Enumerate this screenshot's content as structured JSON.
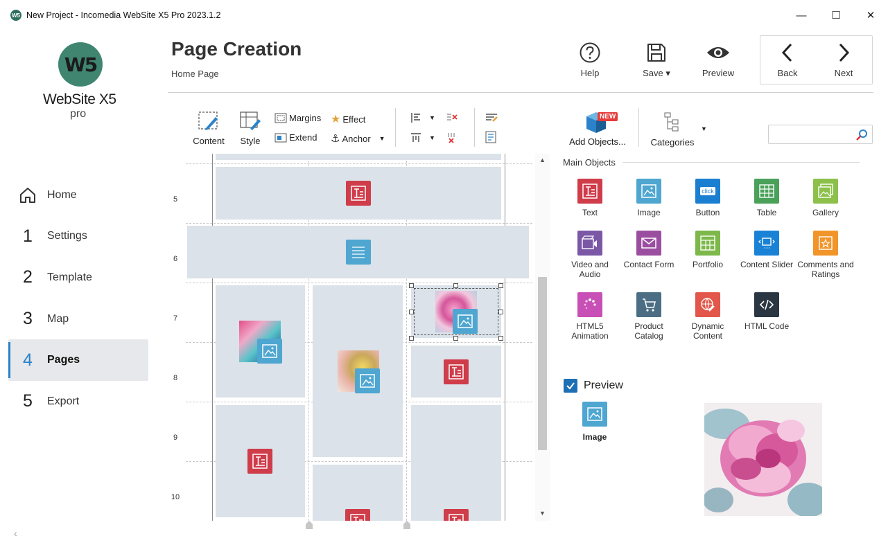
{
  "window": {
    "title": "New Project - Incomedia WebSite X5 Pro 2023.1.2",
    "app_icon_text": "W5",
    "minimize": "—",
    "maximize": "☐",
    "close": "✕"
  },
  "logo": {
    "mark": "W5",
    "name": "WebSite X5",
    "edition": "pro"
  },
  "nav": [
    {
      "num": "",
      "label": "Home"
    },
    {
      "num": "1",
      "label": "Settings"
    },
    {
      "num": "2",
      "label": "Template"
    },
    {
      "num": "3",
      "label": "Map"
    },
    {
      "num": "4",
      "label": "Pages"
    },
    {
      "num": "5",
      "label": "Export"
    }
  ],
  "header": {
    "title": "Page Creation",
    "breadcrumb": "Home Page",
    "help": "Help",
    "save": "Save ▾",
    "preview": "Preview",
    "back": "Back",
    "next": "Next"
  },
  "toolbar": {
    "content": "Content",
    "style": "Style",
    "margins": "Margins",
    "effect": "Effect",
    "extend": "Extend",
    "anchor": "Anchor",
    "add_objects": "Add Objects...",
    "new_badge": "NEW",
    "categories": "Categories",
    "search_placeholder": ""
  },
  "canvas": {
    "rows": [
      "5",
      "6",
      "7",
      "8",
      "9",
      "10"
    ]
  },
  "objects_panel": {
    "section": "Main Objects",
    "items": [
      {
        "name": "Text",
        "color": "#cf3c4a"
      },
      {
        "name": "Image",
        "color": "#4ea6d1"
      },
      {
        "name": "Button",
        "color": "#1b7fd1"
      },
      {
        "name": "Table",
        "color": "#4aa15a"
      },
      {
        "name": "Gallery",
        "color": "#8cc04b"
      },
      {
        "name": "Video and Audio",
        "color": "#7b58a6"
      },
      {
        "name": "Contact Form",
        "color": "#9b4ea0"
      },
      {
        "name": "Portfolio",
        "color": "#7db84b"
      },
      {
        "name": "Content Slider",
        "color": "#1a82d6"
      },
      {
        "name": "Comments and Ratings",
        "color": "#f1952a"
      },
      {
        "name": "HTML5 Animation",
        "color": "#c84fb5"
      },
      {
        "name": "Product Catalog",
        "color": "#4c6e84"
      },
      {
        "name": "Dynamic Content",
        "color": "#e2574a"
      },
      {
        "name": "HTML Code",
        "color": "#2a3642"
      }
    ]
  },
  "preview": {
    "label": "Preview",
    "checked": true,
    "object_name": "Image"
  }
}
